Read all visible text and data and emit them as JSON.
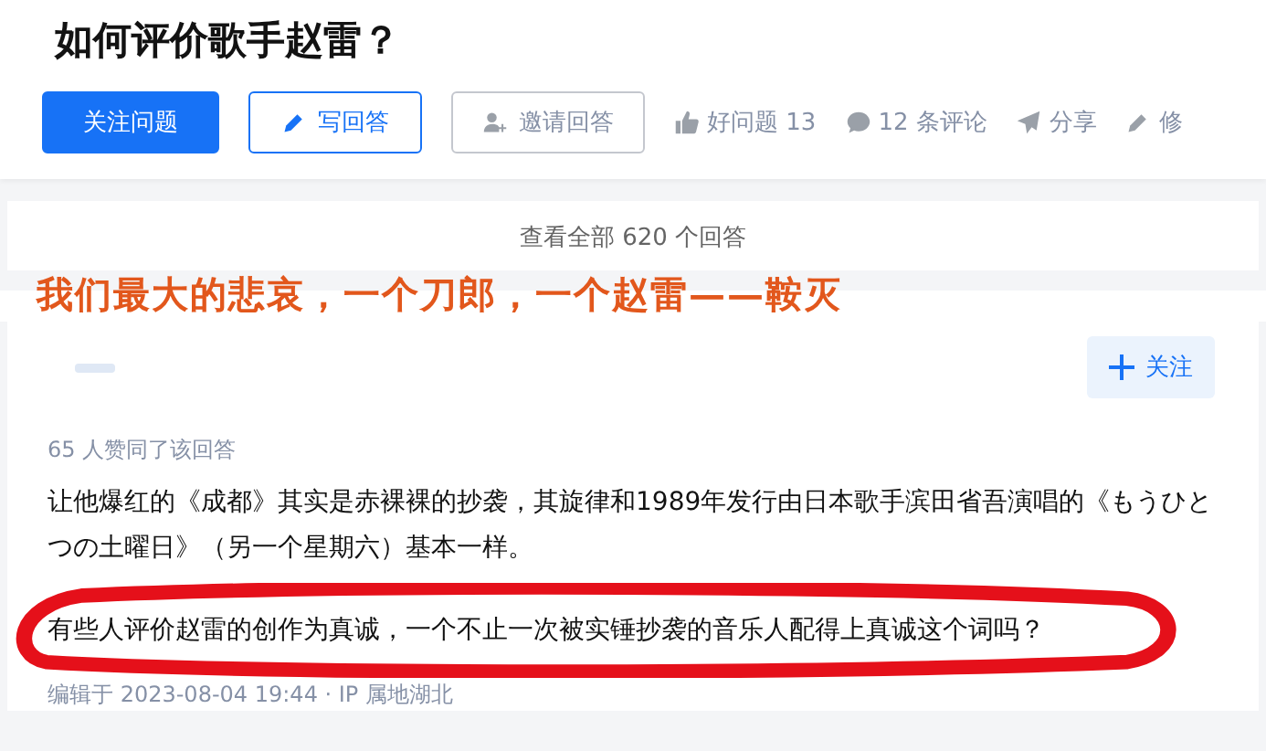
{
  "question": {
    "title": "如何评价歌手赵雷？"
  },
  "actions": [
    {
      "kind": "primary",
      "label": "关注问题"
    },
    {
      "kind": "outline",
      "label": "写回答"
    },
    {
      "kind": "plain",
      "label": "邀请回答"
    }
  ],
  "meta": [
    {
      "kind": "like",
      "label": "好问题 13"
    },
    {
      "kind": "comment",
      "label": "12 条评论"
    },
    {
      "kind": "share",
      "label": "分享"
    },
    {
      "kind": "edit",
      "label": "修"
    }
  ],
  "view_all": "查看全部 620 个回答",
  "caption": "我们最大的悲哀，一个刀郎，一个赵雷——鞍灭",
  "answer": {
    "follow_label": "关注",
    "votes": "65 人赞同了该回答",
    "paragraphs": [
      {
        "text": "让他爆红的《成都》其实是赤裸裸的抄袭，其旋律和1989年发行由日本歌手滨田省吾演唱的《もうひとつの土曜日》（另一个星期六）基本一样。",
        "circled": false
      },
      {
        "text": "有些人评价赵雷的创作为真诚，一个不止一次被实锤抄袭的音乐人配得上真诚这个词吗？",
        "circled": true
      }
    ],
    "edited": "编辑于 2023-08-04 19:44 · IP 属地湖北"
  }
}
